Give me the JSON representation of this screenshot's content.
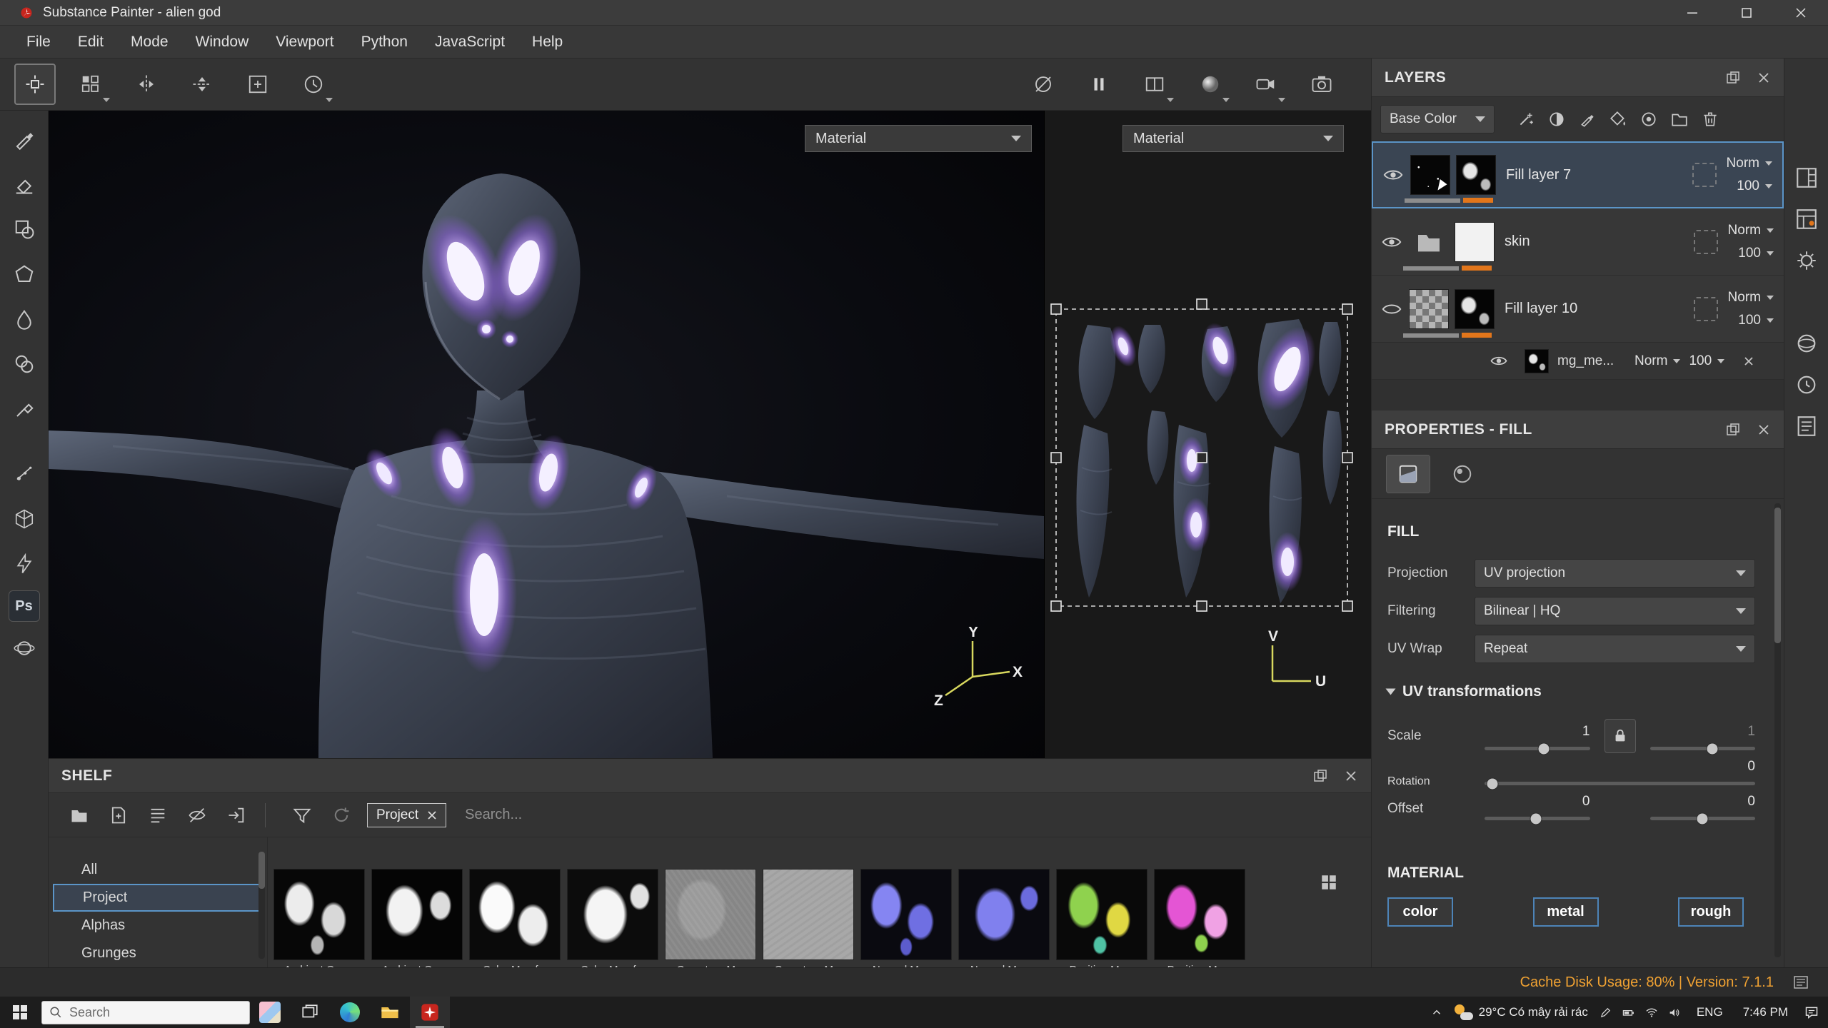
{
  "titlebar": {
    "title": "Substance Painter - alien god"
  },
  "menubar": {
    "items": [
      "File",
      "Edit",
      "Mode",
      "Window",
      "Viewport",
      "Python",
      "JavaScript",
      "Help"
    ]
  },
  "viewports": {
    "left": {
      "material": "Material",
      "axis_x": "X",
      "axis_y": "Y",
      "axis_z": "Z"
    },
    "right": {
      "material": "Material",
      "axis_u": "U",
      "axis_v": "V"
    }
  },
  "tools": {
    "ps_label": "Ps"
  },
  "layers": {
    "title": "LAYERS",
    "channel": "Base Color",
    "rows": [
      {
        "name": "Fill layer 7",
        "blend": "Norm",
        "opacity": "100"
      },
      {
        "name": "skin",
        "blend": "Norm",
        "opacity": "100"
      },
      {
        "name": "Fill layer 10",
        "blend": "Norm",
        "opacity": "100"
      }
    ],
    "subrow": {
      "name": "mg_me...",
      "blend": "Norm",
      "opacity": "100"
    }
  },
  "properties": {
    "title": "PROPERTIES - FILL",
    "fill": {
      "heading": "FILL",
      "projection_label": "Projection",
      "projection": "UV projection",
      "filtering_label": "Filtering",
      "filtering": "Bilinear | HQ",
      "uvwrap_label": "UV Wrap",
      "uvwrap": "Repeat"
    },
    "uv": {
      "heading": "UV transformations",
      "scale_label": "Scale",
      "scale_u": "1",
      "scale_v": "1",
      "rotation_label": "Rotation",
      "rotation": "0",
      "offset_label": "Offset",
      "offset_u": "0",
      "offset_v": "0"
    },
    "material": {
      "heading": "MATERIAL",
      "channels": [
        "color",
        "metal",
        "rough"
      ]
    }
  },
  "shelf": {
    "title": "SHELF",
    "tag": "Project",
    "search_placeholder": "Search...",
    "categories": [
      "All",
      "Project",
      "Alphas",
      "Grunges"
    ],
    "thumbs": [
      {
        "label": "Ambient Occ..."
      },
      {
        "label": "Ambient Occ..."
      },
      {
        "label": "Color Map f..."
      },
      {
        "label": "Color Map f..."
      },
      {
        "label": "Curvature M..."
      },
      {
        "label": "Curvature M..."
      },
      {
        "label": "Normal Map..."
      },
      {
        "label": "Normal Map..."
      },
      {
        "label": "Position Ma..."
      },
      {
        "label": "Position Ma..."
      }
    ]
  },
  "statusbar": {
    "text": "Cache Disk Usage: 80% | Version: 7.1.1"
  },
  "taskbar": {
    "search_placeholder": "Search",
    "weather": "29°C Có mây rải rác",
    "lang": "ENG",
    "time": "7:46 PM"
  }
}
